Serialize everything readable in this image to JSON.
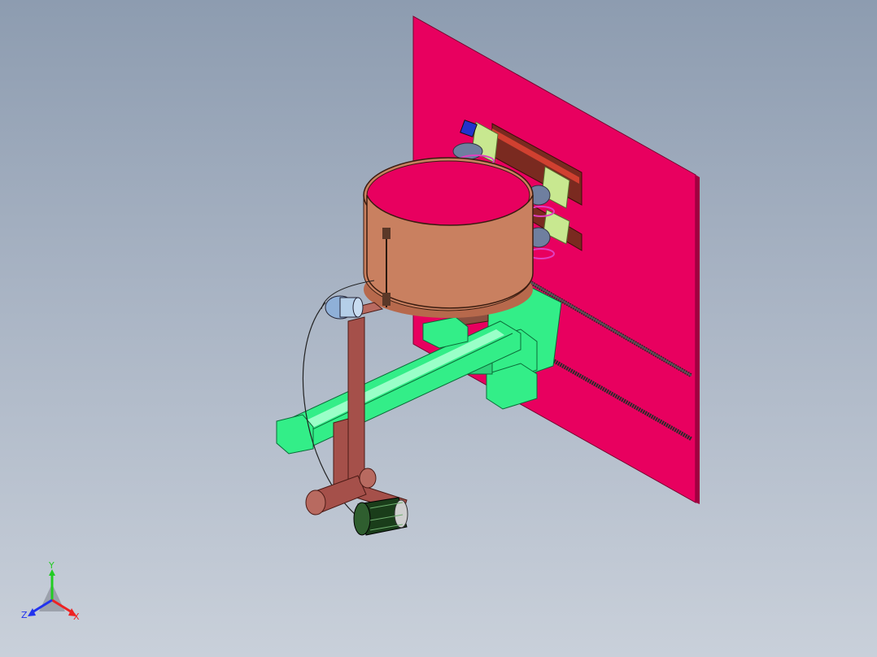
{
  "viewport": {
    "background_top": "#8d9cb0",
    "background_bottom": "#c9d0da"
  },
  "colors": {
    "wall_plate": "#e8005f",
    "drum": "#c98060",
    "arm": "#33ee88",
    "column": "#a5504a",
    "roller": "#1a3d1a",
    "rail": "#2b2b2b",
    "bracket": "#e0a0ff"
  },
  "triad": {
    "y_label": "Y",
    "z_label": "Z",
    "x_label": "X",
    "y_color": "#22cc22",
    "z_color": "#2233ee",
    "x_color": "#ee2222"
  },
  "icons": [
    "coordinate-triad-icon"
  ]
}
